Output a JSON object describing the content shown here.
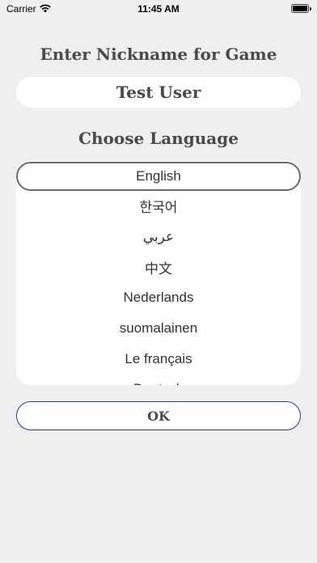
{
  "status_bar": {
    "carrier": "Carrier",
    "time": "11:45 AM",
    "wifi_icon": "wifi-icon",
    "battery_icon": "battery-icon"
  },
  "nickname": {
    "title": "Enter Nickname for Game",
    "value": "Test User"
  },
  "language": {
    "title": "Choose Language",
    "selected": "English",
    "items": [
      {
        "label": "English"
      },
      {
        "label": "한국어"
      },
      {
        "label": "عربي"
      },
      {
        "label": "中文"
      },
      {
        "label": "Nederlands"
      },
      {
        "label": "suomalainen"
      },
      {
        "label": "Le français"
      },
      {
        "label": "Deutsch"
      }
    ]
  },
  "actions": {
    "ok_label": "OK"
  },
  "colors": {
    "background": "#efefef",
    "title_text": "#4a4a4a",
    "ok_border": "#2a3a8a"
  }
}
